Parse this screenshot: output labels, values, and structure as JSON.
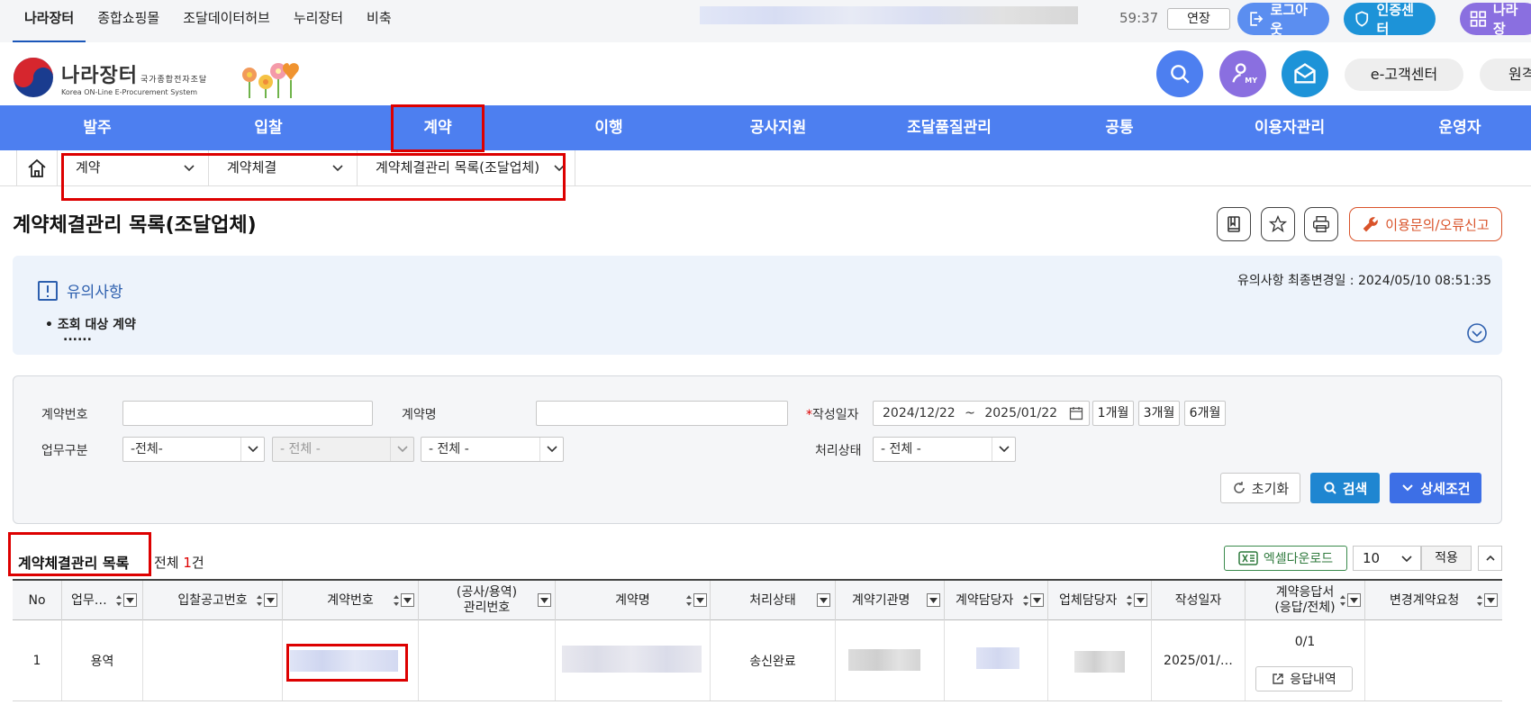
{
  "topbar": {
    "links": [
      "나라장터",
      "종합쇼핑몰",
      "조달데이터허브",
      "누리장터",
      "비축"
    ],
    "timer": "59:37",
    "extend_label": "연장",
    "logout_label": "로그아웃",
    "cert_label": "인증센터",
    "narajangter_label": "나라장"
  },
  "logo": {
    "main": "나라장터",
    "tag": "국가종합전자조달",
    "sub": "Korea ON-Line E-Procurement System"
  },
  "header": {
    "my_label": "MY",
    "ecenter_label": "e-고객센터",
    "ecenter2_label": "원격"
  },
  "nav": {
    "items": [
      "발주",
      "입찰",
      "계약",
      "이행",
      "공사지원",
      "조달품질관리",
      "공통",
      "이용자관리",
      "운영자"
    ]
  },
  "breadcrumb": {
    "items": [
      "계약",
      "계약체결",
      "계약체결관리 목록(조달업체)"
    ]
  },
  "page": {
    "title": "계약체결관리 목록(조달업체)",
    "report_label": "이용문의/오류신고"
  },
  "notice": {
    "title": "유의사항",
    "date": "유의사항 최종변경일 : 2024/05/10 08:51:35",
    "item": "• 조회 대상 계약",
    "dots": "......"
  },
  "search": {
    "contract_no_label": "계약번호",
    "contract_name_label": "계약명",
    "date_label": "작성일자",
    "date_required": "*",
    "date_from": "2024/12/22",
    "date_sep": "~",
    "date_to": "2025/01/22",
    "period_buttons": [
      "1개월",
      "3개월",
      "6개월"
    ],
    "business_label": "업무구분",
    "business_sel1": "-전체-",
    "business_sel2": "- 전체 -",
    "business_sel3": "- 전체 -",
    "status_label": "처리상태",
    "status_sel": "- 전체 -",
    "reset_label": "초기화",
    "search_label": "검색",
    "detail_label": "상세조건"
  },
  "list": {
    "title": "계약체결관리 목록",
    "count_prefix": "전체 ",
    "count": "1",
    "count_suffix": "건",
    "excel_label": "엑셀다운로드",
    "page_size": "10",
    "apply_label": "적용"
  },
  "grid": {
    "headers": [
      "No",
      "업무…",
      "입찰공고번호",
      "계약번호",
      "(공사/용역)",
      "관리번호",
      "계약명",
      "처리상태",
      "계약기관명",
      "계약담당자",
      "업체담당자",
      "작성일자",
      "계약응답서",
      "(응답/전체)",
      "변경계약요청"
    ],
    "row": {
      "no": "1",
      "business": "용역",
      "status": "송신완료",
      "date": "2025/01/…",
      "response": "0/1",
      "response_btn": "응답내역"
    }
  }
}
